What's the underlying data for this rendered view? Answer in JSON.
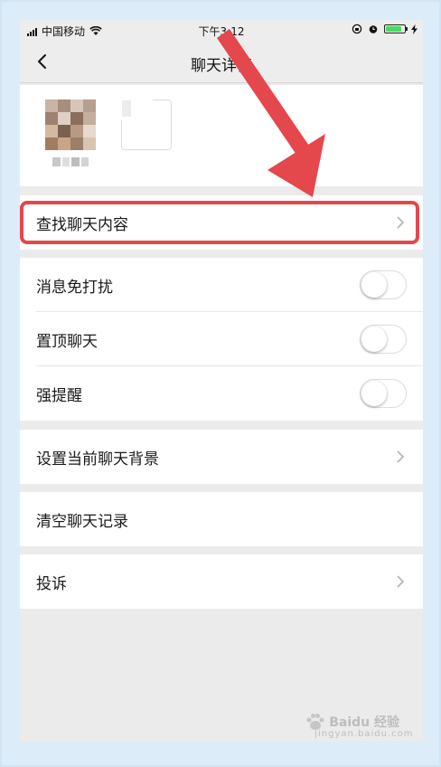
{
  "status_bar": {
    "carrier": "中国移动",
    "time": "下午3:12",
    "battery_level": 0.85,
    "colors": {
      "battery": "#4cd964"
    }
  },
  "nav": {
    "title": "聊天详情"
  },
  "sections": {
    "search": {
      "label": "查找聊天内容"
    },
    "dnd": {
      "label": "消息免打扰",
      "on": false
    },
    "pin": {
      "label": "置顶聊天",
      "on": false
    },
    "alert": {
      "label": "强提醒",
      "on": false
    },
    "background": {
      "label": "设置当前聊天背景"
    },
    "clear": {
      "label": "清空聊天记录"
    },
    "complain": {
      "label": "投诉"
    }
  },
  "annotation": {
    "highlight_color": "#e4474c"
  },
  "watermark": {
    "text": "Baidu 经验",
    "sub": "jingyan.baidu.com"
  }
}
